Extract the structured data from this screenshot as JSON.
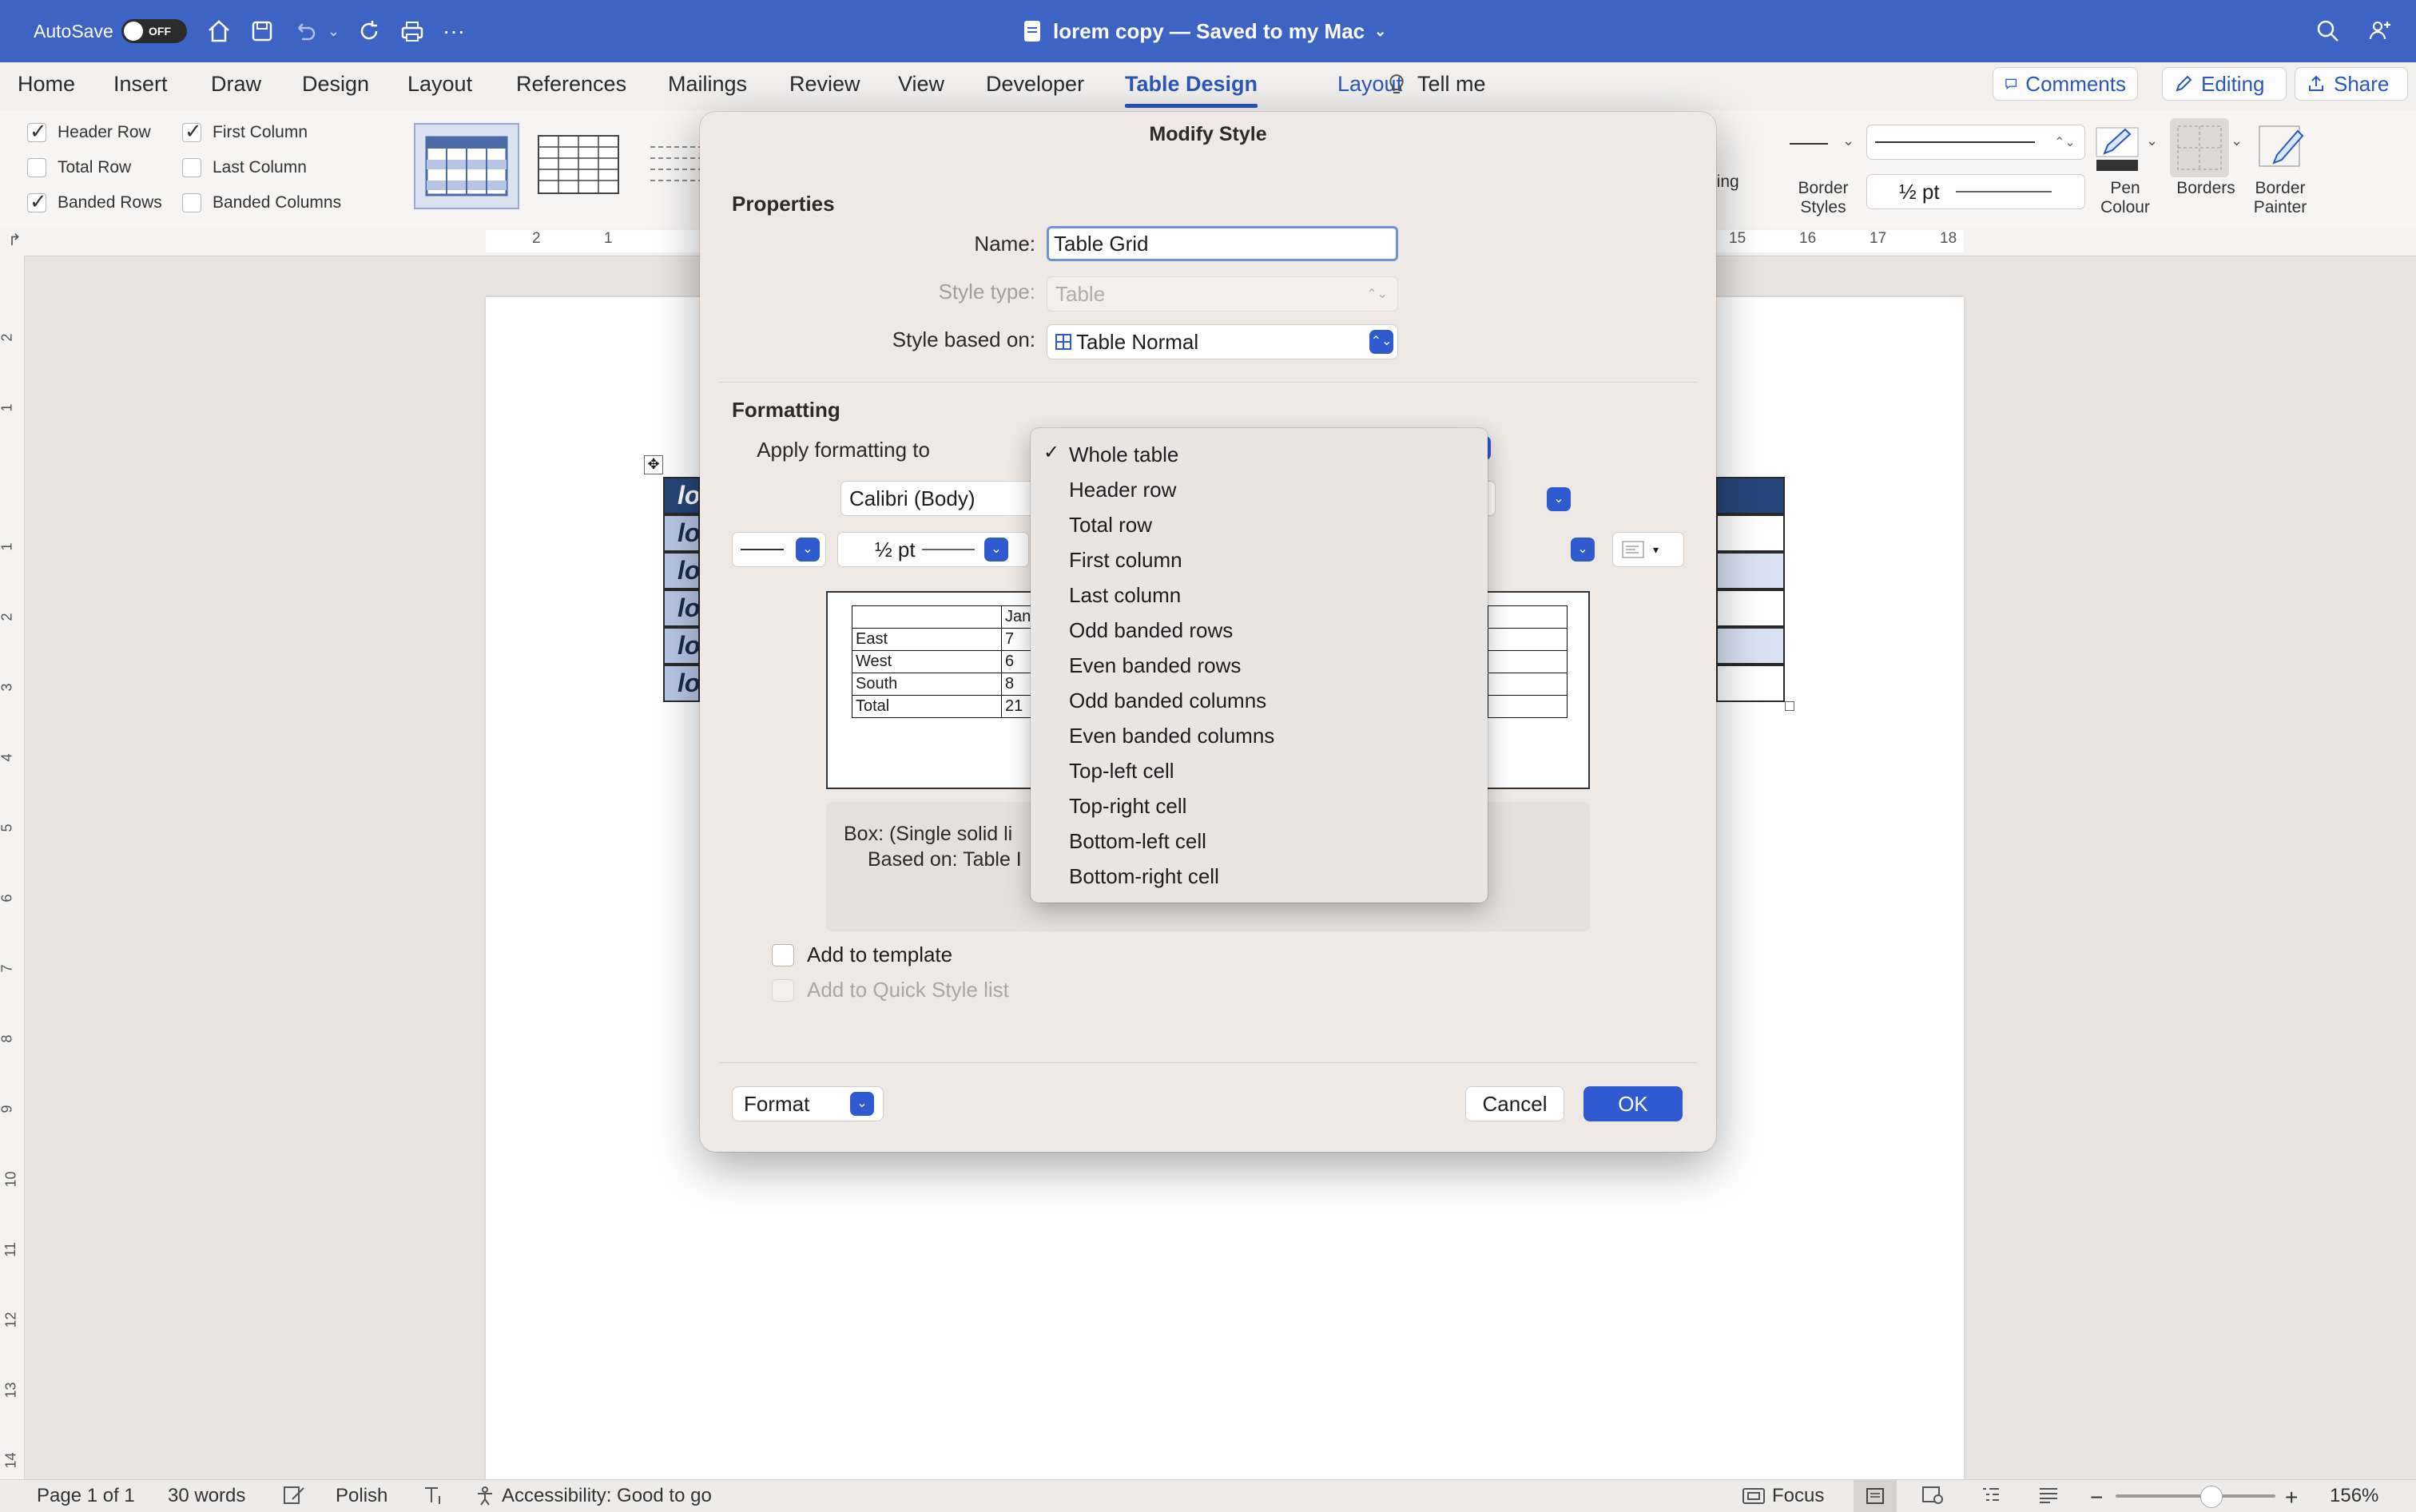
{
  "titlebar": {
    "autosave_label": "AutoSave",
    "autosave_state": "OFF",
    "doc_title": "lorem copy — Saved to my Mac",
    "icons": [
      "home-icon",
      "save-icon",
      "undo-icon",
      "redo-icon",
      "print-icon",
      "more-icon",
      "search-icon",
      "share-people-icon"
    ]
  },
  "tabs": [
    "Home",
    "Insert",
    "Draw",
    "Design",
    "Layout",
    "References",
    "Mailings",
    "Review",
    "View",
    "Developer",
    "Table Design",
    "Layout"
  ],
  "active_tab": "Table Design",
  "tell_me": "Tell me",
  "top_buttons": {
    "comments": "Comments",
    "editing": "Editing",
    "share": "Share"
  },
  "ribbon": {
    "options": [
      {
        "label": "Header Row",
        "checked": true
      },
      {
        "label": "First Column",
        "checked": true
      },
      {
        "label": "Total Row",
        "checked": false
      },
      {
        "label": "Last Column",
        "checked": false
      },
      {
        "label": "Banded Rows",
        "checked": true
      },
      {
        "label": "Banded Columns",
        "checked": false
      }
    ],
    "shading_partial": "ling",
    "border_styles": "Border Styles",
    "pen_weight": "½ pt",
    "pen_colour": "Pen Colour",
    "borders": "Borders",
    "border_painter": "Border Painter"
  },
  "ruler": {
    "left_nums": [
      "2",
      "1"
    ],
    "right_nums": [
      "15",
      "16",
      "17",
      "18"
    ]
  },
  "vruler": [
    "2",
    "1",
    "1",
    "2",
    "3",
    "4",
    "5",
    "6",
    "7",
    "8",
    "9",
    "10",
    "11",
    "12",
    "13",
    "14"
  ],
  "doc_table_cells": [
    "lo",
    "lo",
    "lo",
    "lo",
    "lo",
    "lo"
  ],
  "dialog": {
    "title": "Modify Style",
    "properties": "Properties",
    "name_label": "Name:",
    "name_value": "Table Grid",
    "style_type_label": "Style type:",
    "style_type_value": "Table",
    "based_on_label": "Style based on:",
    "based_on_value": "Table Normal",
    "formatting": "Formatting",
    "apply_label": "Apply formatting to",
    "font_value": "Calibri (Body)",
    "line_weight": "½ pt",
    "preview_header": "Jan",
    "preview_rows": [
      [
        "East",
        "7"
      ],
      [
        "West",
        "6"
      ],
      [
        "South",
        "8"
      ],
      [
        "Total",
        "21"
      ]
    ],
    "desc_line1": "Box: (Single solid li",
    "desc_line2": "Based on: Table I",
    "add_template": "Add to template",
    "add_quick": "Add to Quick Style list",
    "format_btn": "Format",
    "cancel_btn": "Cancel",
    "ok_btn": "OK"
  },
  "dropdown": {
    "selected": "Whole table",
    "items": [
      "Whole table",
      "Header row",
      "Total row",
      "First column",
      "Last column",
      "Odd banded rows",
      "Even banded rows",
      "Odd banded columns",
      "Even banded columns",
      "Top-left cell",
      "Top-right cell",
      "Bottom-left cell",
      "Bottom-right cell"
    ]
  },
  "status": {
    "page": "Page 1 of 1",
    "words": "30 words",
    "language": "Polish",
    "accessibility": "Accessibility: Good to go",
    "focus": "Focus",
    "zoom": "156%"
  },
  "colors": {
    "accent": "#3d63c5",
    "button_blue": "#2f5ad0",
    "table_header": "#27467a",
    "table_band": "#b9c9e6"
  }
}
